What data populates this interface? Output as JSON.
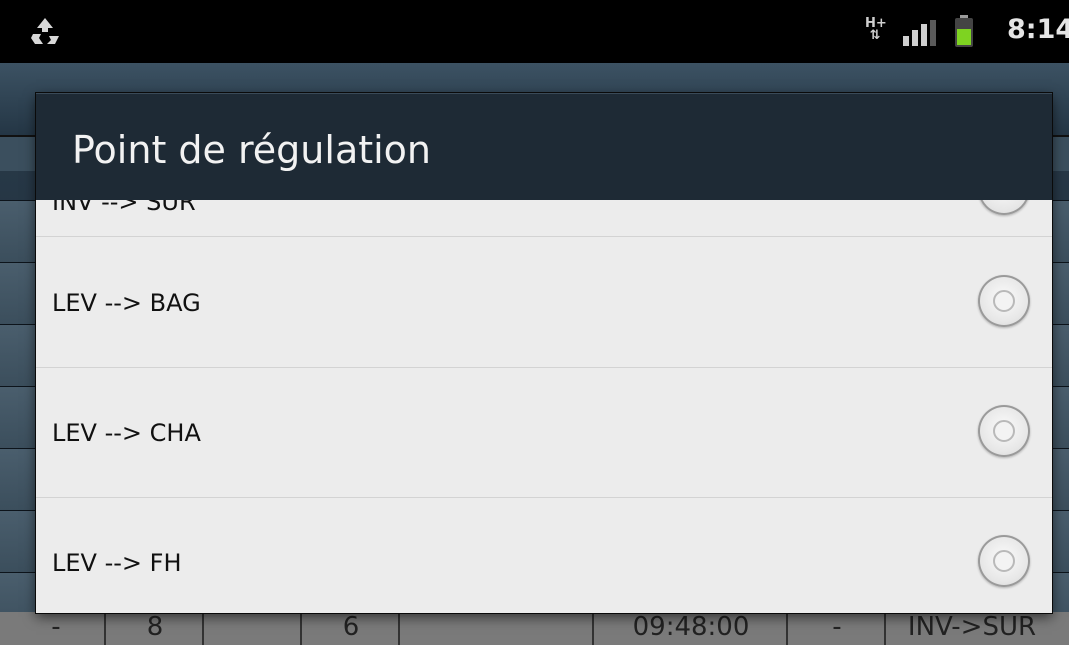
{
  "status_bar": {
    "network_type": "H+",
    "time": "8:14"
  },
  "dialog": {
    "title": "Point de régulation",
    "options": [
      {
        "label": "INV --> SUR",
        "selected": true
      },
      {
        "label": "LEV --> BAG",
        "selected": false
      },
      {
        "label": "LEV --> CHA",
        "selected": false
      },
      {
        "label": "LEV --> FH",
        "selected": false
      }
    ]
  },
  "background_row": {
    "cells": [
      "-",
      "8",
      "",
      "6",
      "",
      "09:48:00",
      "-",
      "INV->SUR"
    ]
  },
  "colors": {
    "dialog_header": "#1e2a35",
    "dialog_body": "#ececec",
    "radio_selected": "#3fa81e"
  }
}
